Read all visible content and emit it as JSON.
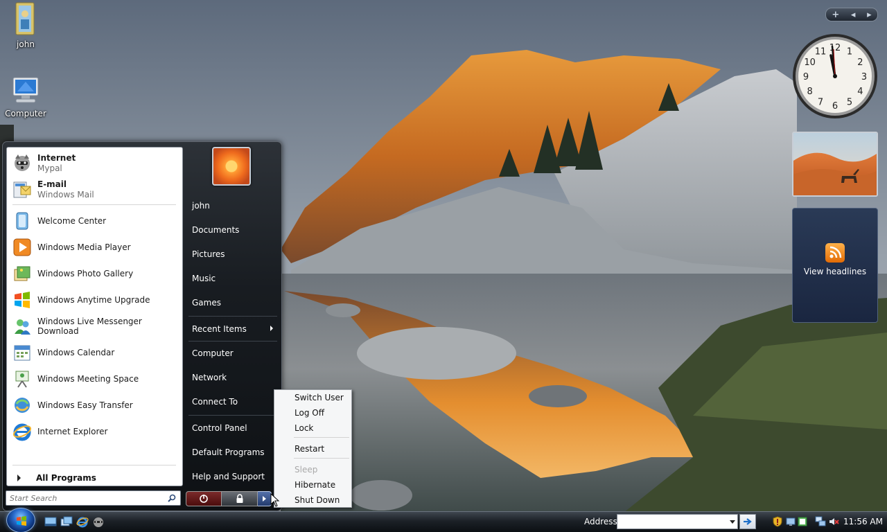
{
  "desktop": {
    "icons": [
      {
        "label": "john",
        "icon": "user-folder-icon"
      },
      {
        "label": "Computer",
        "icon": "computer-icon"
      }
    ]
  },
  "sidebar": {
    "controls": {
      "add": "+",
      "prev": "◂",
      "next": "▸"
    },
    "clock_gadget": {
      "numbers": [
        "12",
        "1",
        "2",
        "3",
        "4",
        "5",
        "6",
        "7",
        "8",
        "9",
        "10",
        "11"
      ],
      "time_shown": "11:56"
    },
    "feed_gadget": {
      "label": "View headlines"
    }
  },
  "start_menu": {
    "pinned": [
      {
        "title": "Internet",
        "subtitle": "Mypal",
        "icon": "raccoon-browser-icon"
      },
      {
        "title": "E-mail",
        "subtitle": "Windows Mail",
        "icon": "mail-icon"
      }
    ],
    "recent": [
      {
        "label": "Welcome Center",
        "icon": "welcome-center-icon"
      },
      {
        "label": "Windows Media Player",
        "icon": "media-player-icon"
      },
      {
        "label": "Windows Photo Gallery",
        "icon": "photo-gallery-icon"
      },
      {
        "label": "Windows Anytime Upgrade",
        "icon": "windows-flag-icon"
      },
      {
        "label": "Windows Live Messenger Download",
        "icon": "messenger-icon"
      },
      {
        "label": "Windows Calendar",
        "icon": "calendar-icon"
      },
      {
        "label": "Windows Meeting Space",
        "icon": "meeting-space-icon"
      },
      {
        "label": "Windows Easy Transfer",
        "icon": "easy-transfer-icon"
      },
      {
        "label": "Internet Explorer",
        "icon": "internet-explorer-icon"
      }
    ],
    "all_programs": "All Programs",
    "search_placeholder": "Start Search",
    "right": {
      "user": "john",
      "documents": "Documents",
      "pictures": "Pictures",
      "music": "Music",
      "games": "Games",
      "recent_items": "Recent Items",
      "computer": "Computer",
      "network": "Network",
      "connect_to": "Connect To",
      "control_panel": "Control Panel",
      "default_programs": "Default Programs",
      "help_support": "Help and Support"
    }
  },
  "power_menu": {
    "switch_user": "Switch User",
    "log_off": "Log Off",
    "lock": "Lock",
    "restart": "Restart",
    "sleep": "Sleep",
    "hibernate": "Hibernate",
    "shut_down": "Shut Down"
  },
  "taskbar": {
    "address_label": "Address",
    "address_value": "",
    "clock": "11:56 AM"
  },
  "colors": {
    "start_menu_bg": "#181c21",
    "taskbar_bg": "#1c2127",
    "power_button": "#7b2b2b",
    "accent_blue": "#2b6ccc"
  }
}
